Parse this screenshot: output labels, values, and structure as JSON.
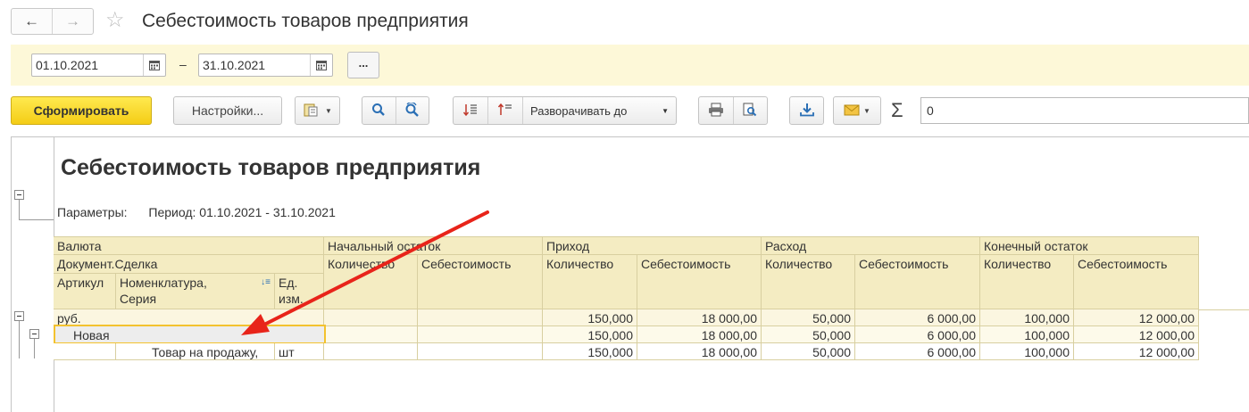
{
  "window": {
    "back_icon": "arrow-left-icon",
    "forward_icon": "arrow-right-icon",
    "favorite_icon": "star-icon",
    "title": "Себестоимость товаров предприятия"
  },
  "period": {
    "start": "01.10.2021",
    "end": "31.10.2021",
    "dash": "–",
    "more_label": "..."
  },
  "toolbar": {
    "generate_label": "Сформировать",
    "settings_label": "Настройки...",
    "expand_label": "Разворачивать до",
    "sigma": "Σ",
    "sum_value": "0"
  },
  "report": {
    "title": "Себестоимость товаров предприятия",
    "params_label": "Параметры:",
    "params_value": "Период: 01.10.2021 - 31.10.2021",
    "headers": {
      "currency": "Валюта",
      "document": "Документ.Сделка",
      "article": "Артикул",
      "nomenclature": "Номенклатура,",
      "series": "Серия",
      "unit1": "Ед.",
      "unit2": "изм.",
      "opening": "Начальный остаток",
      "income": "Приход",
      "expense": "Расход",
      "closing": "Конечный остаток",
      "qty": "Количество",
      "cost": "Себестоимость"
    },
    "rows": [
      {
        "label": "руб.",
        "values": [
          "",
          "",
          "150,000",
          "18 000,00",
          "50,000",
          "6 000,00",
          "100,000",
          "12 000,00"
        ]
      },
      {
        "label": "Новая",
        "values": [
          "",
          "",
          "150,000",
          "18 000,00",
          "50,000",
          "6 000,00",
          "100,000",
          "12 000,00"
        ]
      },
      {
        "label": "Товар на продажу,",
        "unit": "шт",
        "values": [
          "",
          "",
          "150,000",
          "18 000,00",
          "50,000",
          "6 000,00",
          "100,000",
          "12 000,00"
        ]
      }
    ]
  },
  "annotation": {
    "arrow_color": "#e8241a"
  }
}
